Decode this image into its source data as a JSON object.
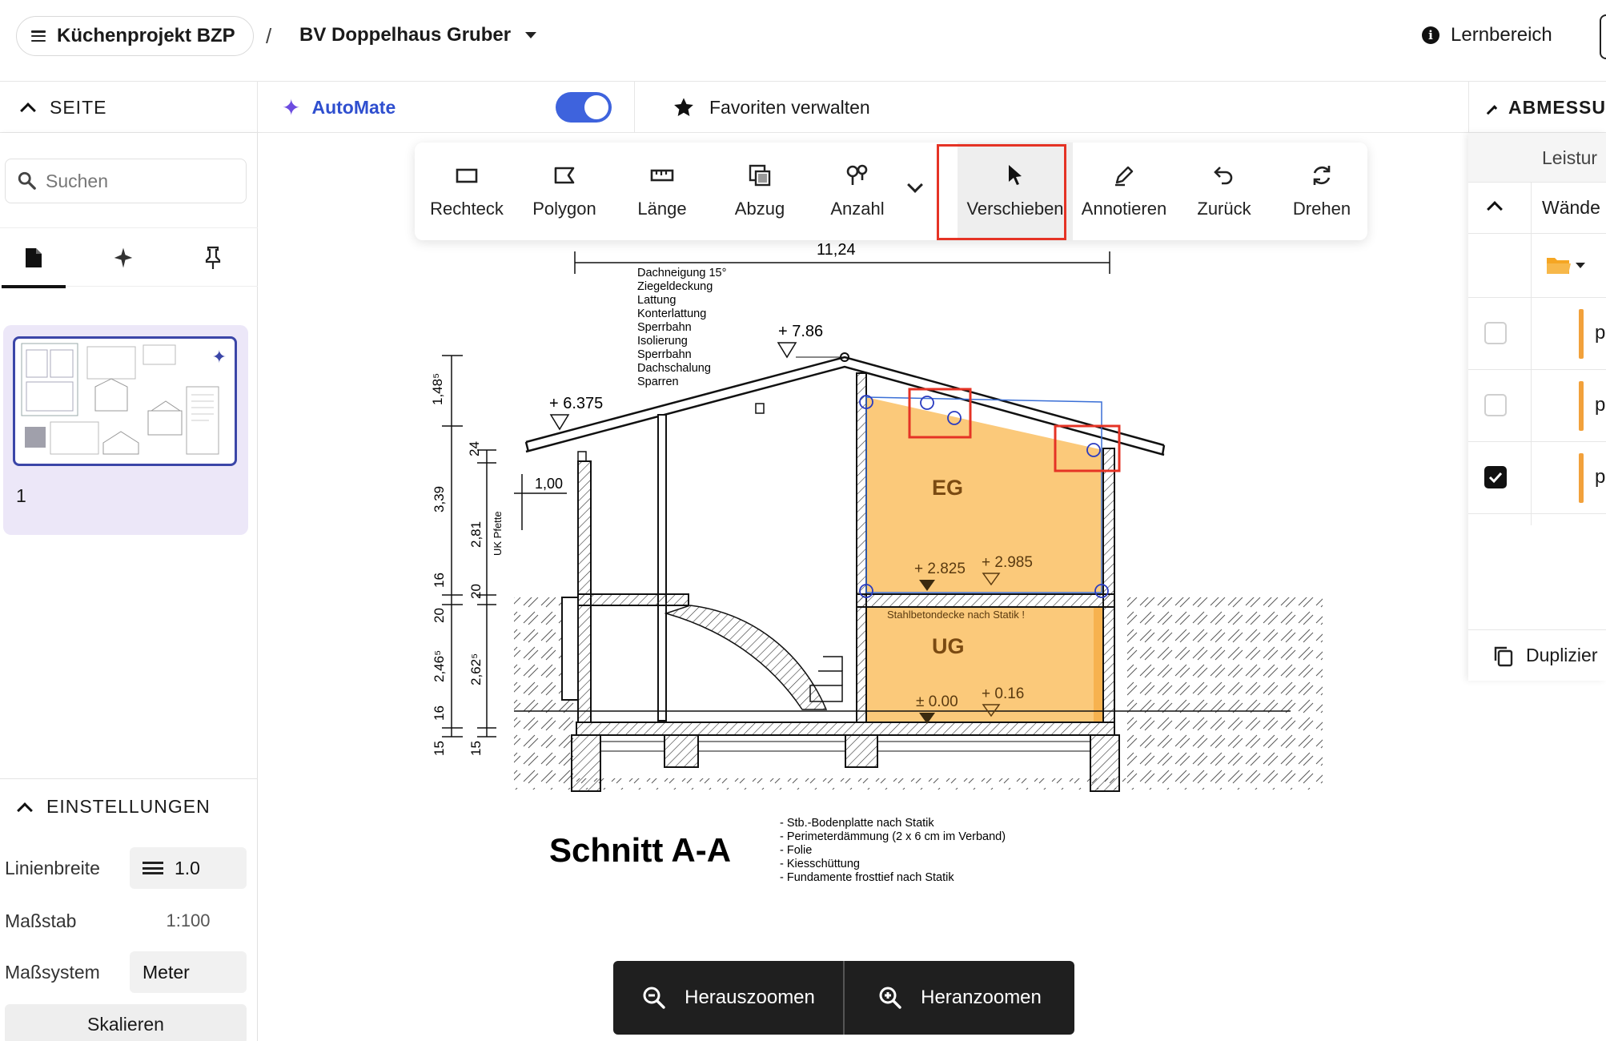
{
  "topbar": {
    "project": "Küchenprojekt BZP",
    "separator": "/",
    "building": "BV Doppelhaus Gruber",
    "help": "Lernbereich"
  },
  "bar2": {
    "seite": "SEITE",
    "automate": "AutoMate",
    "automate_enabled": true,
    "favorites": "Favoriten verwalten",
    "abmessungen": "ABMESSU"
  },
  "sidebar": {
    "search_placeholder": "Suchen",
    "page_number": "1",
    "settings_title": "EINSTELLUNGEN",
    "settings": {
      "linewidth_label": "Linienbreite",
      "linewidth_value": "1.0",
      "scale_label": "Maßstab",
      "scale_value": "1:100",
      "system_label": "Maßsystem",
      "system_value": "Meter",
      "scale_button": "Skalieren"
    }
  },
  "toolbar": {
    "tools": [
      {
        "label": "Rechteck",
        "icon": "rectangle-icon"
      },
      {
        "label": "Polygon",
        "icon": "polygon-icon"
      },
      {
        "label": "Länge",
        "icon": "ruler-icon"
      },
      {
        "label": "Abzug",
        "icon": "subtract-icon"
      },
      {
        "label": "Anzahl",
        "icon": "count-icon"
      },
      {
        "label": "Verschieben",
        "icon": "pointer-icon",
        "selected": true
      },
      {
        "label": "Annotieren",
        "icon": "pen-icon"
      },
      {
        "label": "Zurück",
        "icon": "undo-icon"
      },
      {
        "label": "Drehen",
        "icon": "rotate-icon"
      }
    ]
  },
  "drawing": {
    "title": "Schnitt A-A",
    "dim_top": "11,24",
    "roof_notes": [
      "Dachneigung 15°",
      "Ziegeldeckung",
      "Lattung",
      "Konterlattung",
      "Sperrbahn",
      "Isolierung",
      "Sperrbahn",
      "Dachschalung",
      "Sparren"
    ],
    "levels": {
      "ridge": "+ 7.86",
      "eave": "+ 6.375",
      "eg_floor": "+ 2.825",
      "eg_floor2": "+ 2.985",
      "ug_floor": "± 0.00",
      "ug_floor2": "+ 0.16"
    },
    "rooms": {
      "eg": "EG",
      "ug": "UG"
    },
    "slab_note": "Stahlbetondecke nach Statik !",
    "dims_vertical": [
      "1,48⁵",
      "3,39",
      "16",
      "20",
      "2,46⁵",
      "16",
      "15",
      "24",
      "2,81",
      "20",
      "2,62⁵",
      "15"
    ],
    "dim_small": "1,00",
    "pfette": "UK Pfette",
    "floor_notes": [
      "- Stb.-Bodenplatte nach Statik",
      "- Perimeterdämmung (2 x 6 cm im Verband)",
      "- Folie",
      "- Kiesschüttung",
      "- Fundamente frosttief nach Statik"
    ],
    "highlight_color": "#fbc97a",
    "selection_color": "#e53325"
  },
  "right_panel": {
    "header": "Leistur",
    "group": "Wände",
    "row_initial": "p",
    "checks": [
      false,
      false,
      true
    ],
    "duplicate": "Duplizier"
  },
  "zoom": {
    "out": "Herauszoomen",
    "in": "Heranzoomen"
  }
}
